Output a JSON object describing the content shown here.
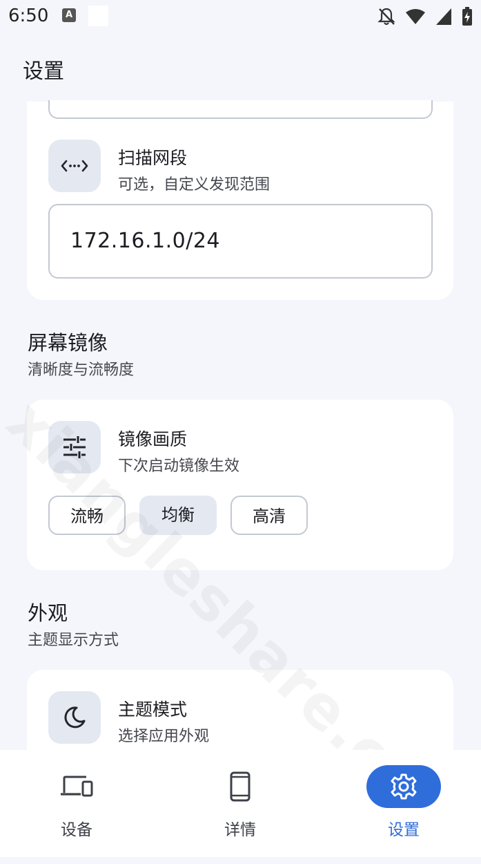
{
  "status_bar": {
    "time": "6:50",
    "notification_a": "A",
    "icons": [
      "notifications-off-icon",
      "wifi-icon",
      "cellular-icon",
      "battery-charging-icon"
    ]
  },
  "header": {
    "title": "设置"
  },
  "scan_card": {
    "item": {
      "title": "扫描网段",
      "subtitle": "可选，自定义发现范围",
      "icon": "code-brackets-icon"
    },
    "field_value": "172.16.1.0/24"
  },
  "mirror_section": {
    "title": "屏幕镜像",
    "subtitle": "清晰度与流畅度"
  },
  "quality_card": {
    "item": {
      "title": "镜像画质",
      "subtitle": "下次启动镜像生效",
      "icon": "tune-icon"
    },
    "options": [
      {
        "label": "流畅",
        "selected": false
      },
      {
        "label": "均衡",
        "selected": true
      },
      {
        "label": "高清",
        "selected": false
      }
    ]
  },
  "appearance_section": {
    "title": "外观",
    "subtitle": "主题显示方式"
  },
  "theme_card": {
    "item": {
      "title": "主题模式",
      "subtitle": "选择应用外观",
      "icon": "moon-icon"
    }
  },
  "bottom_nav": {
    "items": [
      {
        "label": "设备",
        "icon": "devices-icon",
        "active": false
      },
      {
        "label": "详情",
        "icon": "smartphone-icon",
        "active": false
      },
      {
        "label": "设置",
        "icon": "gear-icon",
        "active": true
      }
    ]
  },
  "watermark": "xiangleshare.com",
  "colors": {
    "accent": "#2f6ddb",
    "background": "#f5f6fb",
    "card": "#ffffff",
    "icon_bg": "#e4e8f1"
  }
}
